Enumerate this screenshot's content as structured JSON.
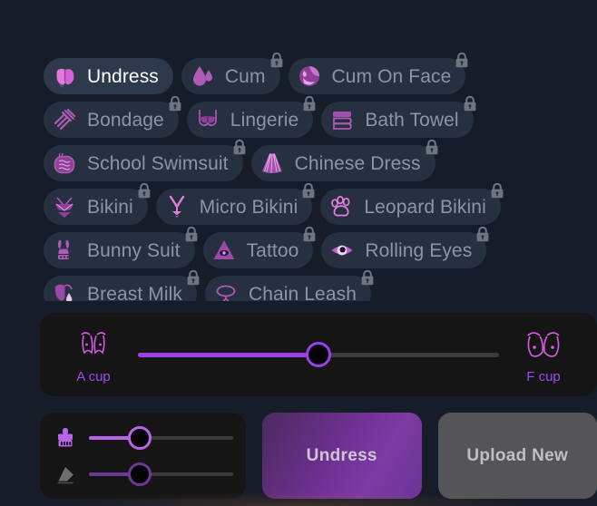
{
  "theme": {
    "page_bg": "#161d29",
    "chip_bg": "#263040",
    "chip_active_bg": "#2e3a4c",
    "panel_bg": "#151516",
    "accent_purple": "#9b3fe8",
    "accent_pink": "#d66ad0",
    "lock_gray": "#6e7480",
    "text_muted": "#8b95a4",
    "text_active": "#ffffff"
  },
  "preset_rows": [
    [
      {
        "label": "Undress",
        "icon": "buttocks-icon",
        "locked": false,
        "active": true
      },
      {
        "label": "Cum",
        "icon": "droplets-icon",
        "locked": true,
        "active": false
      },
      {
        "label": "Cum On Face",
        "icon": "face-splash-icon",
        "locked": true,
        "active": false
      }
    ],
    [
      {
        "label": "Bondage",
        "icon": "rope-coil-icon",
        "locked": true,
        "active": false
      },
      {
        "label": "Lingerie",
        "icon": "bra-icon",
        "locked": true,
        "active": false
      },
      {
        "label": "Bath Towel",
        "icon": "folded-towel-icon",
        "locked": true,
        "active": false
      }
    ],
    [
      {
        "label": "School Swimsuit",
        "icon": "swimsuit-icon",
        "locked": true,
        "active": false
      },
      {
        "label": "Chinese Dress",
        "icon": "qipao-skirt-icon",
        "locked": true,
        "active": false
      }
    ],
    [
      {
        "label": "Bikini",
        "icon": "bikini-icon",
        "locked": true,
        "active": false
      },
      {
        "label": "Micro Bikini",
        "icon": "micro-bikini-icon",
        "locked": true,
        "active": false
      },
      {
        "label": "Leopard Bikini",
        "icon": "paw-print-icon",
        "locked": true,
        "active": false
      }
    ],
    [
      {
        "label": "Bunny Suit",
        "icon": "bunny-icon",
        "locked": true,
        "active": false
      },
      {
        "label": "Tattoo",
        "icon": "triangle-eye-icon",
        "locked": true,
        "active": false
      },
      {
        "label": "Rolling Eyes",
        "icon": "eye-icon",
        "locked": true,
        "active": false
      }
    ],
    [
      {
        "label": "Breast Milk",
        "icon": "milk-drop-icon",
        "locked": true,
        "active": false
      },
      {
        "label": "Chain Leash",
        "icon": "chain-collar-icon",
        "locked": true,
        "active": false
      }
    ]
  ],
  "breast_size_slider": {
    "min_label": "A cup",
    "max_label": "F cup",
    "min_icon": "small-breasts-icon",
    "max_icon": "large-breasts-icon",
    "value_percent": 50
  },
  "brush_controls": [
    {
      "icon": "brush-icon",
      "value_percent": 35,
      "fill_color": "#b864e8"
    },
    {
      "icon": "eraser-icon",
      "value_percent": 35,
      "fill_color": "#6b3a96"
    }
  ],
  "actions": {
    "primary_label": "Undress",
    "secondary_label": "Upload New"
  }
}
